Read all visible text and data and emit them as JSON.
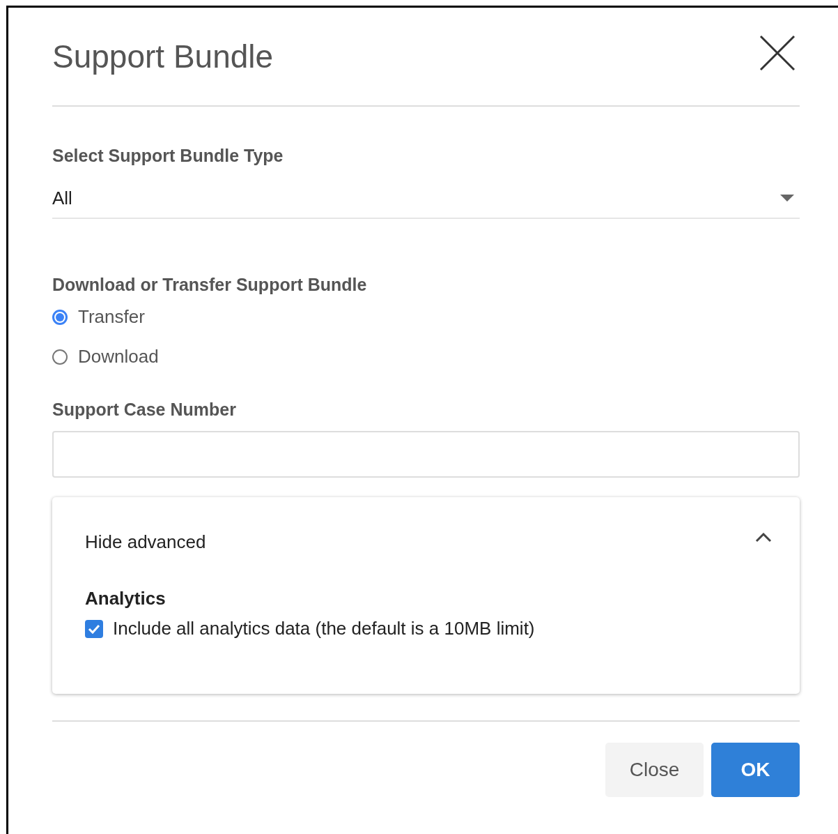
{
  "dialog": {
    "title": "Support Bundle"
  },
  "bundle_type": {
    "label": "Select Support Bundle Type",
    "value": "All"
  },
  "delivery": {
    "label": "Download or Transfer Support Bundle",
    "options": [
      {
        "label": "Transfer",
        "selected": true
      },
      {
        "label": "Download",
        "selected": false
      }
    ]
  },
  "case_number": {
    "label": "Support Case Number"
  },
  "advanced": {
    "toggle": "Hide advanced",
    "expanded": true,
    "heading": "Analytics",
    "checkbox": {
      "label": "Include all analytics data (the default is a 10MB limit)",
      "checked": true
    }
  },
  "buttons": [
    {
      "label": "Close",
      "kind": "secondary"
    },
    {
      "label": "OK",
      "kind": "primary"
    }
  ]
}
